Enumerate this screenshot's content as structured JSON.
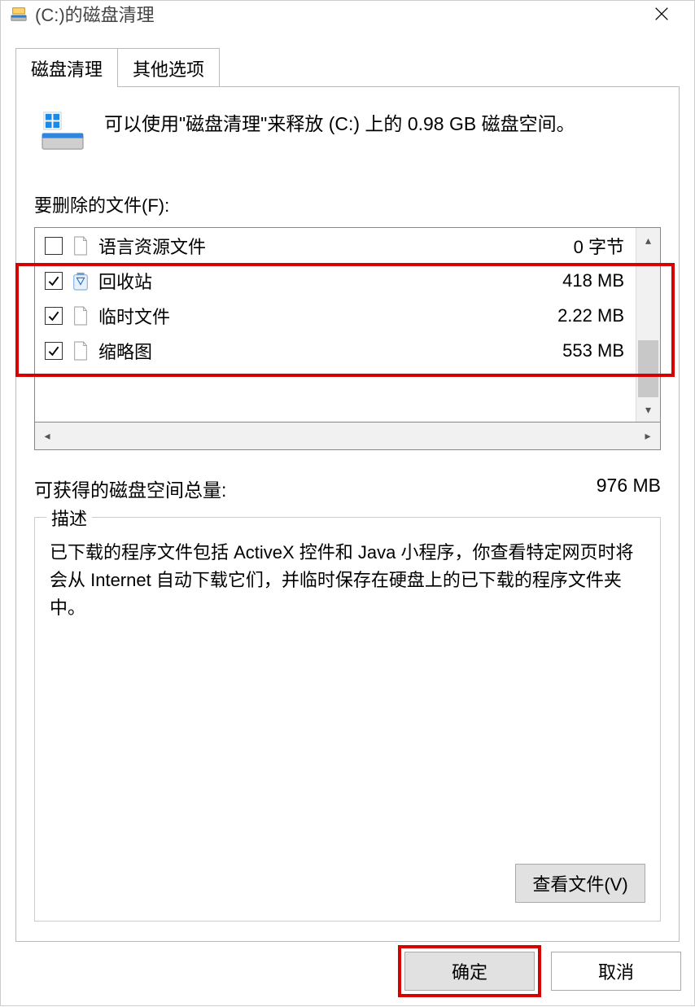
{
  "window": {
    "title": "(C:)的磁盘清理"
  },
  "tabs": {
    "active": "磁盘清理",
    "inactive": "其他选项"
  },
  "info": "可以使用\"磁盘清理\"来释放  (C:) 上的 0.98 GB 磁盘空间。",
  "files_label": "要删除的文件(F):",
  "items": [
    {
      "checked": false,
      "icon": "file",
      "name": "语言资源文件",
      "size": "0 字节"
    },
    {
      "checked": true,
      "icon": "recycle",
      "name": "回收站",
      "size": "418 MB"
    },
    {
      "checked": true,
      "icon": "file",
      "name": "临时文件",
      "size": "2.22 MB"
    },
    {
      "checked": true,
      "icon": "file",
      "name": "缩略图",
      "size": "553 MB"
    }
  ],
  "total": {
    "label": "可获得的磁盘空间总量:",
    "value": "976 MB"
  },
  "description": {
    "legend": "描述",
    "text": "已下载的程序文件包括 ActiveX 控件和 Java 小程序，你查看特定网页时将会从 Internet 自动下载它们，并临时保存在硬盘上的已下载的程序文件夹中。"
  },
  "buttons": {
    "view_files": "查看文件(V)",
    "ok": "确定",
    "cancel": "取消"
  }
}
